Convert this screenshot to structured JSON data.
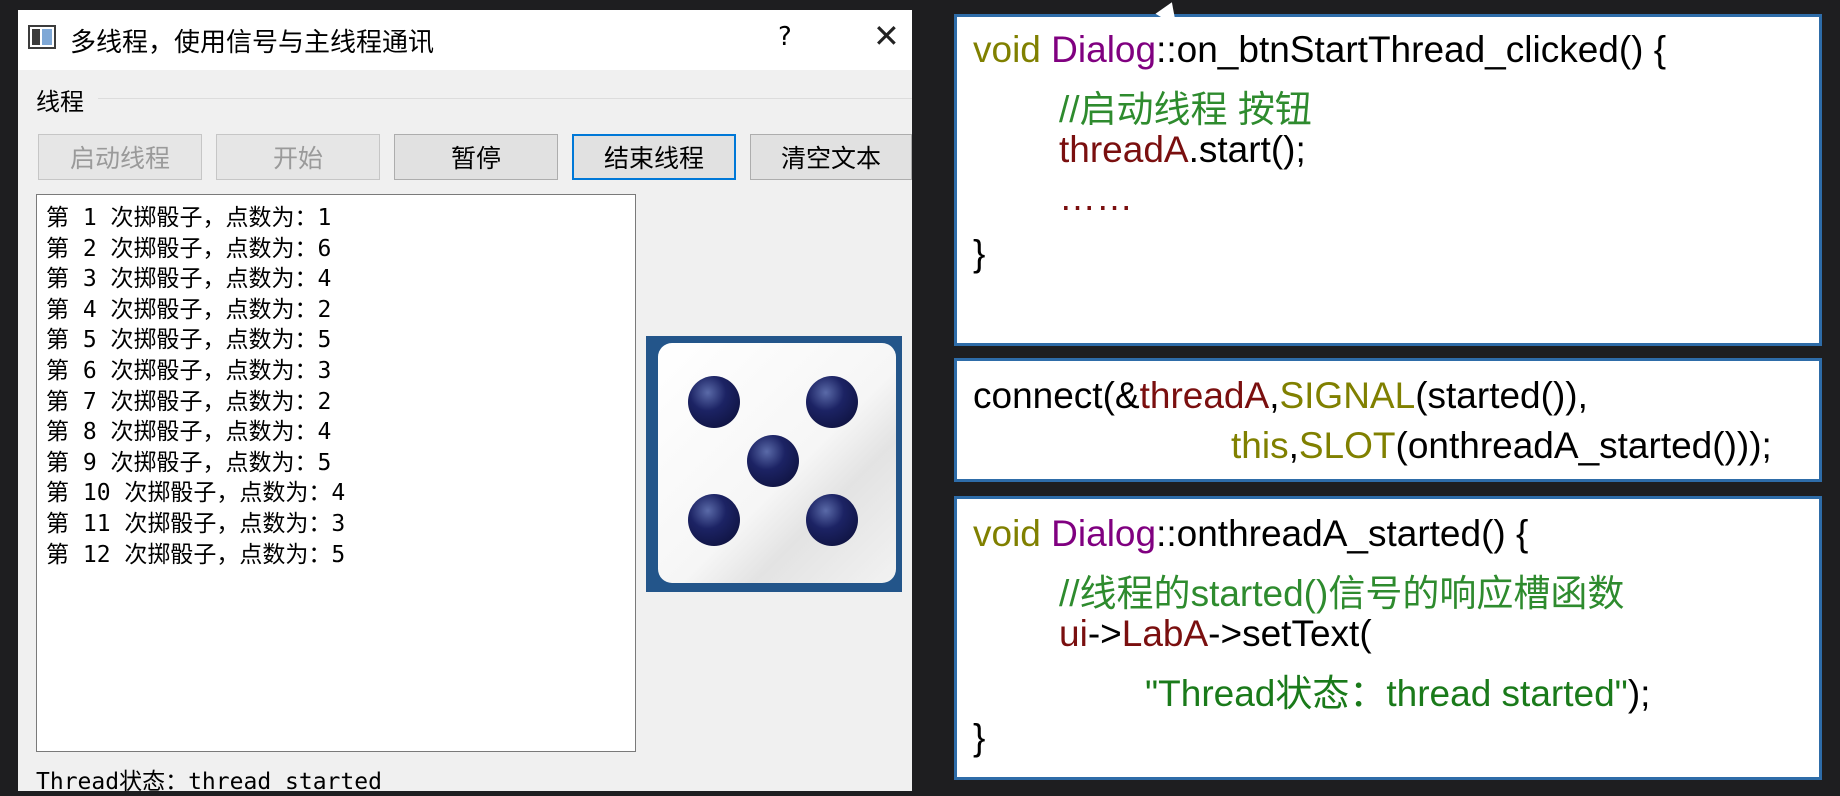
{
  "window": {
    "title": "多线程，使用信号与主线程通讯",
    "help": "?",
    "close": "✕"
  },
  "group": {
    "label": "线程"
  },
  "buttons": {
    "start_thread": "启动线程",
    "begin": "开始",
    "pause": "暂停",
    "end_thread": "结束线程",
    "clear_text": "清空文本"
  },
  "log_lines": [
    "第 1 次掷骰子，点数为：1",
    "第 2 次掷骰子，点数为：6",
    "第 3 次掷骰子，点数为：4",
    "第 4 次掷骰子，点数为：2",
    "第 5 次掷骰子，点数为：5",
    "第 6 次掷骰子，点数为：3",
    "第 7 次掷骰子，点数为：2",
    "第 8 次掷骰子，点数为：4",
    "第 9 次掷骰子，点数为：5",
    "第 10 次掷骰子，点数为：4",
    "第 11 次掷骰子，点数为：3",
    "第 12 次掷骰子，点数为：5"
  ],
  "dice": {
    "face_value": 5
  },
  "status": "Thread状态：thread started",
  "code": {
    "p1": {
      "void": "void",
      "cls": "Dialog",
      "sig": "::on_btnStartThread_clicked() {",
      "comment": "//启动线程 按钮",
      "var": "threadA",
      "call": ".start();",
      "ellipsis": "……",
      "close": "}"
    },
    "p2": {
      "c1": "connect(&",
      "var": "threadA",
      "comma": ",",
      "signal": "SIGNAL",
      "c2": "(started()),",
      "this_kw": "this",
      "comma2": ",",
      "slot": "SLOT",
      "c3": "(onthreadA_started()));"
    },
    "p3": {
      "void": "void",
      "cls": "Dialog",
      "sig": "::onthreadA_started() {",
      "comment1": "//线程的",
      "comment2": "started()",
      "comment3": "信号的响应槽函数",
      "ui": "ui",
      "arrow": "->",
      "lab": "LabA",
      "settext": "->setText(",
      "str": "\"Thread状态：thread started\"",
      "end": ");",
      "close": "}"
    }
  }
}
